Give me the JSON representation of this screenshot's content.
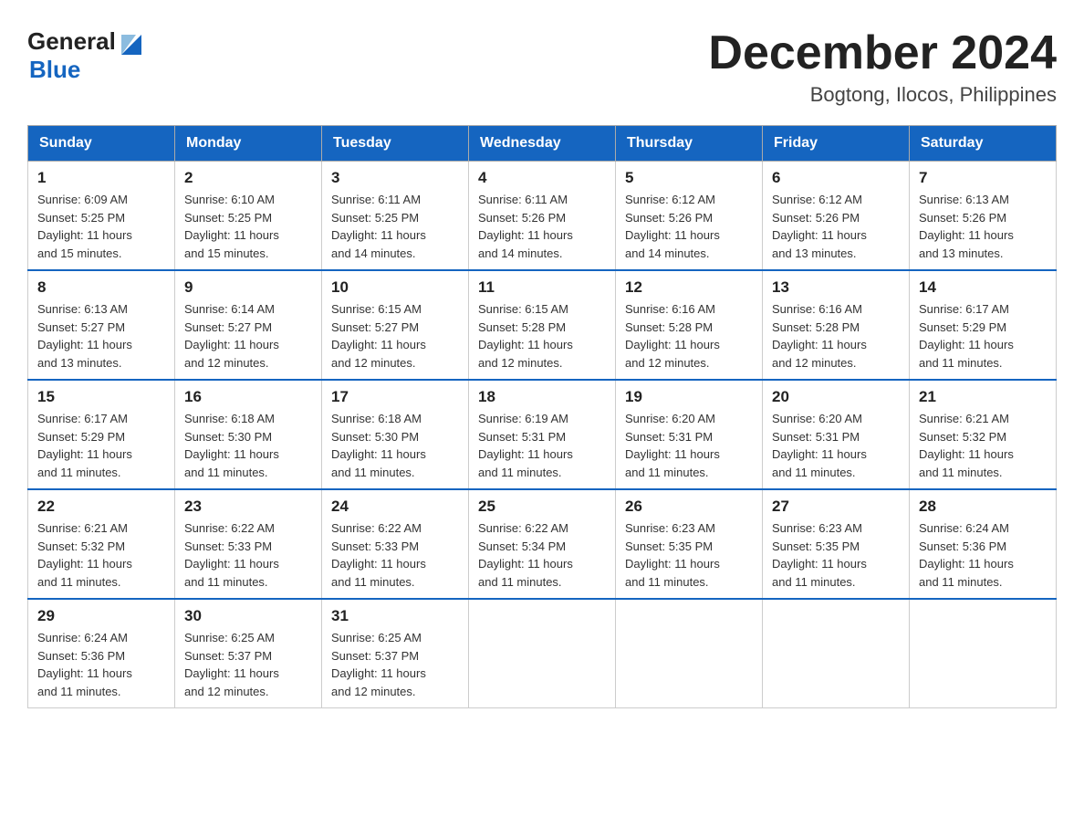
{
  "header": {
    "logo_general": "General",
    "logo_blue": "Blue",
    "month_title": "December 2024",
    "location": "Bogtong, Ilocos, Philippines"
  },
  "days_of_week": [
    "Sunday",
    "Monday",
    "Tuesday",
    "Wednesday",
    "Thursday",
    "Friday",
    "Saturday"
  ],
  "weeks": [
    [
      {
        "day": "1",
        "sunrise": "6:09 AM",
        "sunset": "5:25 PM",
        "daylight": "11 hours and 15 minutes."
      },
      {
        "day": "2",
        "sunrise": "6:10 AM",
        "sunset": "5:25 PM",
        "daylight": "11 hours and 15 minutes."
      },
      {
        "day": "3",
        "sunrise": "6:11 AM",
        "sunset": "5:25 PM",
        "daylight": "11 hours and 14 minutes."
      },
      {
        "day": "4",
        "sunrise": "6:11 AM",
        "sunset": "5:26 PM",
        "daylight": "11 hours and 14 minutes."
      },
      {
        "day": "5",
        "sunrise": "6:12 AM",
        "sunset": "5:26 PM",
        "daylight": "11 hours and 14 minutes."
      },
      {
        "day": "6",
        "sunrise": "6:12 AM",
        "sunset": "5:26 PM",
        "daylight": "11 hours and 13 minutes."
      },
      {
        "day": "7",
        "sunrise": "6:13 AM",
        "sunset": "5:26 PM",
        "daylight": "11 hours and 13 minutes."
      }
    ],
    [
      {
        "day": "8",
        "sunrise": "6:13 AM",
        "sunset": "5:27 PM",
        "daylight": "11 hours and 13 minutes."
      },
      {
        "day": "9",
        "sunrise": "6:14 AM",
        "sunset": "5:27 PM",
        "daylight": "11 hours and 12 minutes."
      },
      {
        "day": "10",
        "sunrise": "6:15 AM",
        "sunset": "5:27 PM",
        "daylight": "11 hours and 12 minutes."
      },
      {
        "day": "11",
        "sunrise": "6:15 AM",
        "sunset": "5:28 PM",
        "daylight": "11 hours and 12 minutes."
      },
      {
        "day": "12",
        "sunrise": "6:16 AM",
        "sunset": "5:28 PM",
        "daylight": "11 hours and 12 minutes."
      },
      {
        "day": "13",
        "sunrise": "6:16 AM",
        "sunset": "5:28 PM",
        "daylight": "11 hours and 12 minutes."
      },
      {
        "day": "14",
        "sunrise": "6:17 AM",
        "sunset": "5:29 PM",
        "daylight": "11 hours and 11 minutes."
      }
    ],
    [
      {
        "day": "15",
        "sunrise": "6:17 AM",
        "sunset": "5:29 PM",
        "daylight": "11 hours and 11 minutes."
      },
      {
        "day": "16",
        "sunrise": "6:18 AM",
        "sunset": "5:30 PM",
        "daylight": "11 hours and 11 minutes."
      },
      {
        "day": "17",
        "sunrise": "6:18 AM",
        "sunset": "5:30 PM",
        "daylight": "11 hours and 11 minutes."
      },
      {
        "day": "18",
        "sunrise": "6:19 AM",
        "sunset": "5:31 PM",
        "daylight": "11 hours and 11 minutes."
      },
      {
        "day": "19",
        "sunrise": "6:20 AM",
        "sunset": "5:31 PM",
        "daylight": "11 hours and 11 minutes."
      },
      {
        "day": "20",
        "sunrise": "6:20 AM",
        "sunset": "5:31 PM",
        "daylight": "11 hours and 11 minutes."
      },
      {
        "day": "21",
        "sunrise": "6:21 AM",
        "sunset": "5:32 PM",
        "daylight": "11 hours and 11 minutes."
      }
    ],
    [
      {
        "day": "22",
        "sunrise": "6:21 AM",
        "sunset": "5:32 PM",
        "daylight": "11 hours and 11 minutes."
      },
      {
        "day": "23",
        "sunrise": "6:22 AM",
        "sunset": "5:33 PM",
        "daylight": "11 hours and 11 minutes."
      },
      {
        "day": "24",
        "sunrise": "6:22 AM",
        "sunset": "5:33 PM",
        "daylight": "11 hours and 11 minutes."
      },
      {
        "day": "25",
        "sunrise": "6:22 AM",
        "sunset": "5:34 PM",
        "daylight": "11 hours and 11 minutes."
      },
      {
        "day": "26",
        "sunrise": "6:23 AM",
        "sunset": "5:35 PM",
        "daylight": "11 hours and 11 minutes."
      },
      {
        "day": "27",
        "sunrise": "6:23 AM",
        "sunset": "5:35 PM",
        "daylight": "11 hours and 11 minutes."
      },
      {
        "day": "28",
        "sunrise": "6:24 AM",
        "sunset": "5:36 PM",
        "daylight": "11 hours and 11 minutes."
      }
    ],
    [
      {
        "day": "29",
        "sunrise": "6:24 AM",
        "sunset": "5:36 PM",
        "daylight": "11 hours and 11 minutes."
      },
      {
        "day": "30",
        "sunrise": "6:25 AM",
        "sunset": "5:37 PM",
        "daylight": "11 hours and 12 minutes."
      },
      {
        "day": "31",
        "sunrise": "6:25 AM",
        "sunset": "5:37 PM",
        "daylight": "11 hours and 12 minutes."
      },
      null,
      null,
      null,
      null
    ]
  ],
  "labels": {
    "sunrise": "Sunrise:",
    "sunset": "Sunset:",
    "daylight": "Daylight:"
  }
}
